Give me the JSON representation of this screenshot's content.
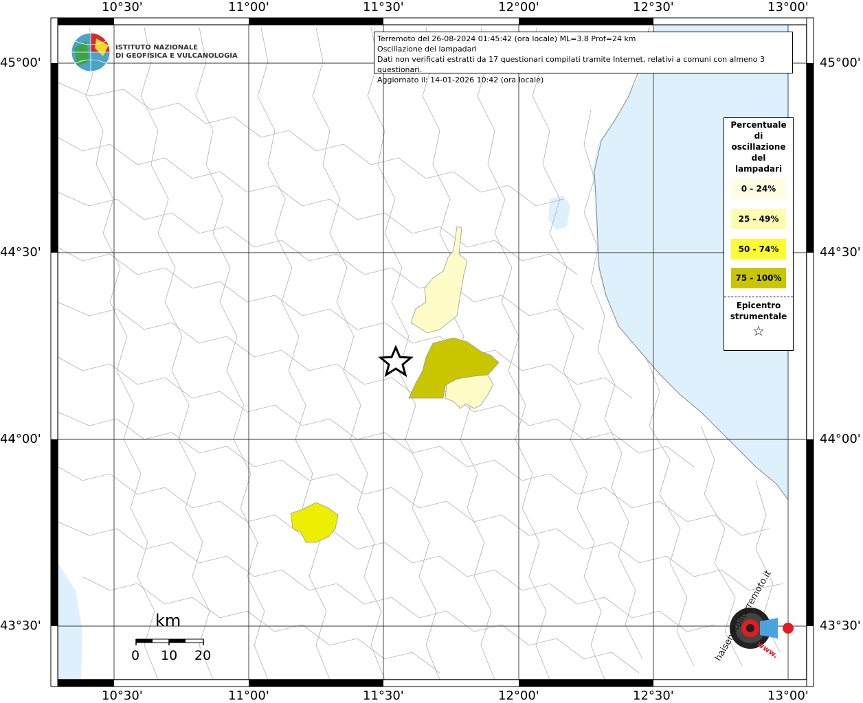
{
  "info": {
    "line1": "Terremoto del 26-08-2024 01:45:42 (ora locale) ML=3.8 Prof=24 km",
    "line2": "Oscillazione dei lampadari",
    "line3": "Dati non verificati estratti da 17 questionari compilati tramite Internet, relativi a comuni con almeno 3 questionari.",
    "line4": "Aggiornato il: 14-01-2026 10:42 (ora locale)"
  },
  "institute": {
    "line1": "ISTITUTO NAZIONALE",
    "line2": "DI GEOFISICA E VULCANOLOGIA"
  },
  "lon_labels": [
    "10°30'",
    "11°00'",
    "11°30'",
    "12°00'",
    "12°30'",
    "13°00'"
  ],
  "lat_labels": [
    "45°00'",
    "44°30'",
    "44°00'",
    "43°30'"
  ],
  "legend": {
    "title_lines": [
      "Percentuale",
      "di",
      "oscillazione",
      "del",
      "lampadari"
    ],
    "classes": [
      {
        "label": "0 - 24%",
        "color": "#fffde3"
      },
      {
        "label": "25 - 49%",
        "color": "#fffcb0"
      },
      {
        "label": "50 - 74%",
        "color": "#fcfc33"
      },
      {
        "label": "75 - 100%",
        "color": "#c9c600"
      }
    ],
    "epicenter_label_1": "Epicentro",
    "epicenter_label_2": "strumentale"
  },
  "scale": {
    "unit": "km",
    "ticks": [
      "0",
      "10",
      "20"
    ]
  },
  "colors": {
    "sea": "#def0fc",
    "border": "#aaaaaa",
    "grid": "#333333"
  },
  "site_logo": {
    "text": "haisentitoilterremoto.it",
    "www": "www."
  }
}
